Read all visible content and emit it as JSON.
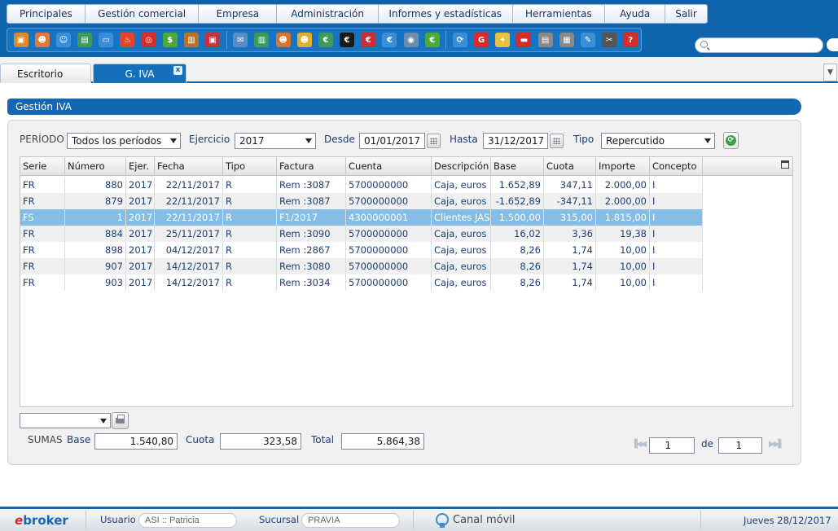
{
  "menu": {
    "items": [
      "Principales",
      "Gestión comercial",
      "Empresa",
      "Administración",
      "Informes y estadísticas",
      "Herramientas",
      "Ayuda",
      "Salir"
    ]
  },
  "toolbar": {
    "icons": [
      {
        "name": "box-icon",
        "color": "#d98a2b",
        "glyph": "▣"
      },
      {
        "name": "user-icon",
        "color": "#e07a3c",
        "glyph": "☻"
      },
      {
        "name": "contact-icon",
        "color": "#3a8ed8",
        "glyph": "☺"
      },
      {
        "name": "table-icon",
        "color": "#3c9a5c",
        "glyph": "▤"
      },
      {
        "name": "window-icon",
        "color": "#3a8ed8",
        "glyph": "▭"
      },
      {
        "name": "fire-icon",
        "color": "#e0442c",
        "glyph": "♨"
      },
      {
        "name": "target-icon",
        "color": "#d82c2c",
        "glyph": "◎"
      },
      {
        "name": "money-icon",
        "color": "#4caa3c",
        "glyph": "$"
      },
      {
        "name": "briefcase-icon",
        "color": "#b7742e",
        "glyph": "▥"
      },
      {
        "name": "safe-icon",
        "color": "#c9303a",
        "glyph": "▣"
      },
      {
        "name": "mail-icon",
        "color": "#5a8cc8",
        "glyph": "✉"
      },
      {
        "name": "building-icon",
        "color": "#3c9a5c",
        "glyph": "▥"
      },
      {
        "name": "agent-icon",
        "color": "#d8742c",
        "glyph": "☻"
      },
      {
        "name": "idea-user-icon",
        "color": "#e0b02c",
        "glyph": "☻"
      },
      {
        "name": "euro-green-icon",
        "color": "#3c9a5c",
        "glyph": "€"
      },
      {
        "name": "euro-black-icon",
        "color": "#1a1a1a",
        "glyph": "€"
      },
      {
        "name": "euro-user-icon",
        "color": "#c9303a",
        "glyph": "€"
      },
      {
        "name": "euro-blue-icon",
        "color": "#3a8ed8",
        "glyph": "€"
      },
      {
        "name": "eye-icon",
        "color": "#6c8db0",
        "glyph": "◉"
      },
      {
        "name": "euro-circle-icon",
        "color": "#4caa3c",
        "glyph": "€"
      },
      {
        "name": "sync-icon",
        "color": "#3a8ed8",
        "glyph": "⟳"
      },
      {
        "name": "google-icon",
        "color": "#d82c2c",
        "glyph": "G"
      },
      {
        "name": "bulb-icon",
        "color": "#e8c23c",
        "glyph": "✦"
      },
      {
        "name": "card-icon",
        "color": "#d82c2c",
        "glyph": "▬"
      },
      {
        "name": "doc-icon",
        "color": "#8a8a8a",
        "glyph": "▤"
      },
      {
        "name": "printer-doc-icon",
        "color": "#8a8a8a",
        "glyph": "▦"
      },
      {
        "name": "pen-icon",
        "color": "#3a8ed8",
        "glyph": "✎"
      },
      {
        "name": "tools-icon",
        "color": "#555555",
        "glyph": "✂"
      },
      {
        "name": "help-icon",
        "color": "#d82c2c",
        "glyph": "?"
      }
    ]
  },
  "tabs": [
    {
      "label": "Escritorio"
    },
    {
      "label": "G. IVA"
    }
  ],
  "panel": {
    "title": "Gestión IVA"
  },
  "filters": {
    "periodo_label": "PERÍODO",
    "periodo_value": "Todos los períodos",
    "ejercicio_label": "Ejercicio",
    "ejercicio_value": "2017",
    "desde_label": "Desde",
    "desde_value": "01/01/2017",
    "hasta_label": "Hasta",
    "hasta_value": "31/12/2017",
    "tipo_label": "Tipo",
    "tipo_value": "Repercutido"
  },
  "grid": {
    "columns": [
      "Serie",
      "Número",
      "Ejer.",
      "Fecha",
      "Tipo",
      "Factura",
      "Cuenta",
      "Descripción",
      "Base",
      "Cuota",
      "Importe",
      "Concepto"
    ],
    "rows": [
      [
        "FR",
        "880",
        "2017",
        "22/11/2017",
        "R",
        "Rem :3087",
        "5700000000",
        "Caja, euros",
        "1.652,89",
        "347,11",
        "2.000,00",
        "I"
      ],
      [
        "FR",
        "879",
        "2017",
        "22/11/2017",
        "R",
        "Rem :3087",
        "5700000000",
        "Caja, euros",
        "-1.652,89",
        "-347,11",
        "2.000,00",
        "I"
      ],
      [
        "FS",
        "1",
        "2017",
        "22/11/2017",
        "R",
        "F1/2017",
        "4300000001",
        "Clientes JASO",
        "1.500,00",
        "315,00",
        "1.815,00",
        "I"
      ],
      [
        "FR",
        "884",
        "2017",
        "25/11/2017",
        "R",
        "Rem :3090",
        "5700000000",
        "Caja, euros",
        "16,02",
        "3,36",
        "19,38",
        "I"
      ],
      [
        "FR",
        "898",
        "2017",
        "04/12/2017",
        "R",
        "Rem :2867",
        "5700000000",
        "Caja, euros",
        "8,26",
        "1,74",
        "10,00",
        "I"
      ],
      [
        "FR",
        "907",
        "2017",
        "14/12/2017",
        "R",
        "Rem :3080",
        "5700000000",
        "Caja, euros",
        "8,26",
        "1,74",
        "10,00",
        "I"
      ],
      [
        "FR",
        "903",
        "2017",
        "14/12/2017",
        "R",
        "Rem :3034",
        "5700000000",
        "Caja, euros",
        "8,26",
        "1,74",
        "10,00",
        "I"
      ]
    ],
    "selected_row": 2
  },
  "sums": {
    "label": "SUMAS",
    "base_label": "Base",
    "base_value": "1.540,80",
    "cuota_label": "Cuota",
    "cuota_value": "323,58",
    "total_label": "Total",
    "total_value": "5.864,38"
  },
  "pager": {
    "page": "1",
    "of_label": "de",
    "total": "1"
  },
  "footer": {
    "logo_e": "e",
    "logo_rest": "broker",
    "usuario_label": "Usuario",
    "usuario_value": "ASI :: Patricia",
    "sucursal_label": "Sucursal",
    "sucursal_value": "PRAVIA",
    "canal_label": "Canal móvil",
    "date": "Jueves 28/12/2017"
  }
}
